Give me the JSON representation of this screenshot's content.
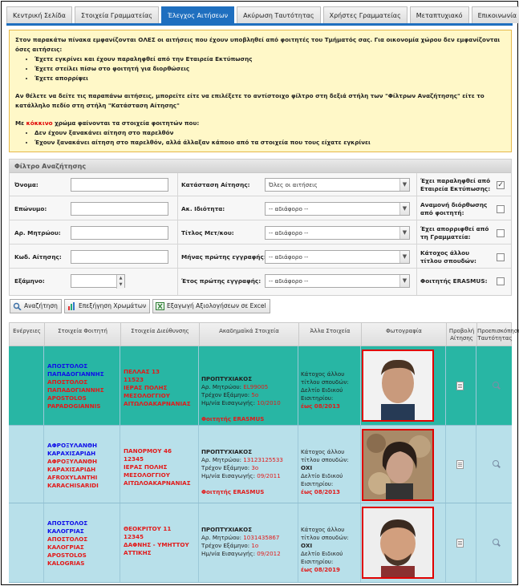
{
  "tabs": [
    {
      "label": "Κεντρική Σελίδα",
      "active": false
    },
    {
      "label": "Στοιχεία Γραμματείας",
      "active": false
    },
    {
      "label": "Έλεγχος Αιτήσεων",
      "active": true
    },
    {
      "label": "Ακύρωση Ταυτότητας",
      "active": false
    },
    {
      "label": "Χρήστες Γραμματείας",
      "active": false
    },
    {
      "label": "Μεταπτυχιακό",
      "active": false
    },
    {
      "label": "Επικοινωνία",
      "active": false
    }
  ],
  "notice": {
    "intro": "Στον παρακάτω πίνακα εμφανίζονται ΟΛΕΣ οι αιτήσεις που έχουν υποβληθεί από φοιτητές του Τμήματός σας. Για οικονομία χώρου δεν εμφανίζονται όσες αιτήσεις:",
    "bullets1": [
      "Έχετε εγκρίνει και έχουν παραληφθεί από την Εταιρεία Εκτύπωσης",
      "Έχετε στείλει πίσω στο φοιτητή για διορθώσεις",
      "Έχετε απορρίψει"
    ],
    "filter_hint": "Αν θέλετε να δείτε τις παραπάνω αιτήσεις, μπορείτε είτε να επιλέξετε το αντίστοιχο φίλτρο στη δεξιά στήλη των \"Φίλτρων Αναζήτησης\" είτε το κατάλληλο πεδίο στη στήλη \"Κατάσταση Αίτησης\"",
    "color_prefix": "Με ",
    "color_word": "κόκκινο",
    "color_suffix": " χρώμα φαίνονται τα στοιχεία φοιτητών που:",
    "bullets2": [
      "Δεν έχουν ξανακάνει αίτηση στο παρελθόν",
      "Έχουν ξανακάνει αίτηση στο παρελθόν, αλλά άλλαξαν κάποιο από τα στοιχεία που τους είχατε εγκρίνει"
    ]
  },
  "filter": {
    "title": "Φίλτρο Αναζήτησης",
    "labels": {
      "first_name": "Όνομα:",
      "last_name": "Επώνυμο:",
      "am": "Αρ. Μητρώου:",
      "app_code": "Κωδ. Αίτησης:",
      "semester": "Εξάμηνο:",
      "status": "Κατάσταση Αίτησης:",
      "acad": "Ακ. Ιδιότητα:",
      "postgrad": "Τίτλος Μετ/κου:",
      "month": "Μήνας πρώτης εγγραφής:",
      "year": "Έτος πρώτης εγγραφής:",
      "received": "Έχει παραληφθεί από Εταιρεία Εκτύπωσης:",
      "awaiting": "Αναμονή διόρθωσης από φοιτητή:",
      "rejected": "Έχει απορριφθεί από τη Γραμματεία:",
      "other_title": "Κάτοχος άλλου τίτλου σπουδών:",
      "erasmus": "Φοιτητής ERASMUS:"
    },
    "selects": {
      "status": "Όλες οι αιτήσεις",
      "acad": "-- αδιάφορο --",
      "postgrad": "-- αδιάφορο --",
      "month": "-- αδιάφορο --",
      "year": "-- αδιάφορο --"
    },
    "checks": {
      "received": true,
      "awaiting": false,
      "rejected": false,
      "other_title": false,
      "erasmus": false
    }
  },
  "buttons": {
    "search": "Αναζήτηση",
    "colors": "Επεξήγηση Χρωμάτων",
    "export": "Εξαγωγή Αξιολογήσεων σε Excel"
  },
  "grid": {
    "headers": [
      "Ενέργειες",
      "Στοιχεία Φοιτητή",
      "Στοιχεία Διεύθυνσης",
      "Ακαδημαϊκά Στοιχεία",
      "Άλλα Στοιχεία",
      "Φωτογραφία",
      "Προβολή Αίτησης",
      "Προεπισκόπηση Ταυτότητας"
    ],
    "rows": [
      {
        "bg": "#28b6a4",
        "name_lines": [
          {
            "text": "ΑΠΟΣΤΟΛΟΣ",
            "color": "blue"
          },
          {
            "text": "ΠΑΠΑΔΟΓΙΑΝΝΗΣ",
            "color": "blue"
          },
          {
            "text": "ΑΠΟΣΤΟΛΟΣ",
            "color": "red"
          },
          {
            "text": "ΠΑΠΑΔΟΓΙΑΝΝΗΣ",
            "color": "red"
          },
          {
            "text": "APOSTOLOS",
            "color": "red"
          },
          {
            "text": "PAPADOGIANNIS",
            "color": "red"
          }
        ],
        "address_lines": [
          "ΠΕΛΛΑΣ 13",
          "11523",
          "ΙΕΡΑΣ ΠΟΛΗΣ",
          "ΜΕΣΟΛΟΓΓΙΟΥ",
          "ΑΙΤΩΛΟΑΚΑΡΝΑΝΙΑΣ"
        ],
        "level": "ΠΡΟΠΤΥΧΙΑΚΟΣ",
        "am_label": "Αρ. Μητρώου: ",
        "am": "EL99005",
        "sem_label": "Τρέχον Εξάμηνο: ",
        "sem": "5ο",
        "entry_label": "Ημ/νία Εισαγωγής: ",
        "entry": "10/2010",
        "erasmus": "Φοιτητής ERASMUS",
        "other_label": "Κάτοχος άλλου τίτλου σπουδών:",
        "other_value": "",
        "valid_label": "Δελτίο Ειδικού Εισιτηρίου:",
        "valid": "έως 08/2013"
      },
      {
        "bg": "#b8e0ea",
        "name_lines": [
          {
            "text": "ΑΦΡΟΞΥΛΑΝΘΗ",
            "color": "blue"
          },
          {
            "text": "ΚΑΡΑΧΙΣΑΡΙΔΗ",
            "color": "blue"
          },
          {
            "text": "ΑΦΡΟΞΥΛΑΝΘΗ",
            "color": "red"
          },
          {
            "text": "ΚΑΡΑΧΙΣΑΡΙΔΗ",
            "color": "red"
          },
          {
            "text": "AFROXYLANTHI",
            "color": "red"
          },
          {
            "text": "KARACHISARIDI",
            "color": "red"
          }
        ],
        "address_lines": [
          "ΠΑΝΟΡΜΟΥ 46",
          "12345",
          "ΙΕΡΑΣ ΠΟΛΗΣ",
          "ΜΕΣΟΛΟΓΓΙΟΥ",
          "ΑΙΤΩΛΟΑΚΑΡΝΑΝΙΑΣ"
        ],
        "level": "ΠΡΟΠΤΥΧΙΑΚΟΣ",
        "am_label": "Αρ. Μητρώου: ",
        "am": "13123125533",
        "sem_label": "Τρέχον Εξάμηνο: ",
        "sem": "3ο",
        "entry_label": "Ημ/νία Εισαγωγής: ",
        "entry": "09/2011",
        "erasmus": "Φοιτητής ERASMUS",
        "other_label": "Κάτοχος άλλου τίτλου σπουδών:",
        "other_value": "ΟΧΙ",
        "valid_label": "Δελτίο Ειδικού Εισιτηρίου:",
        "valid": "έως 08/2013"
      },
      {
        "bg": "#b8e0ea",
        "name_lines": [
          {
            "text": "ΑΠΟΣΤΟΛΟΣ",
            "color": "blue"
          },
          {
            "text": "ΚΑΛΟΓΡΙΑΣ",
            "color": "blue"
          },
          {
            "text": "ΑΠΟΣΤΟΛΟΣ",
            "color": "red"
          },
          {
            "text": "ΚΑΛΟΓΡΙΑΣ",
            "color": "red"
          },
          {
            "text": "APOSTOLOS",
            "color": "red"
          },
          {
            "text": "KALOGRIAS",
            "color": "red"
          }
        ],
        "address_lines": [
          "ΘΕΟΚΡΙΤΟΥ 11",
          "12345",
          "ΔΑΦΝΗΣ - ΥΜΗΤΤΟΥ",
          "ΑΤΤΙΚΗΣ"
        ],
        "level": "ΠΡΟΠΤΥΧΙΑΚΟΣ",
        "am_label": "Αρ. Μητρώου: ",
        "am": "1031435867",
        "sem_label": "Τρέχον Εξάμηνο: ",
        "sem": "1ο",
        "entry_label": "Ημ/νία Εισαγωγής: ",
        "entry": "09/2012",
        "erasmus": "",
        "other_label": "Κάτοχος άλλου τίτλου σπουδών:",
        "other_value": "ΟΧΙ",
        "valid_label": "Δελτίο Ειδικού Εισιτηρίου:",
        "valid": "έως 08/2019"
      }
    ]
  }
}
